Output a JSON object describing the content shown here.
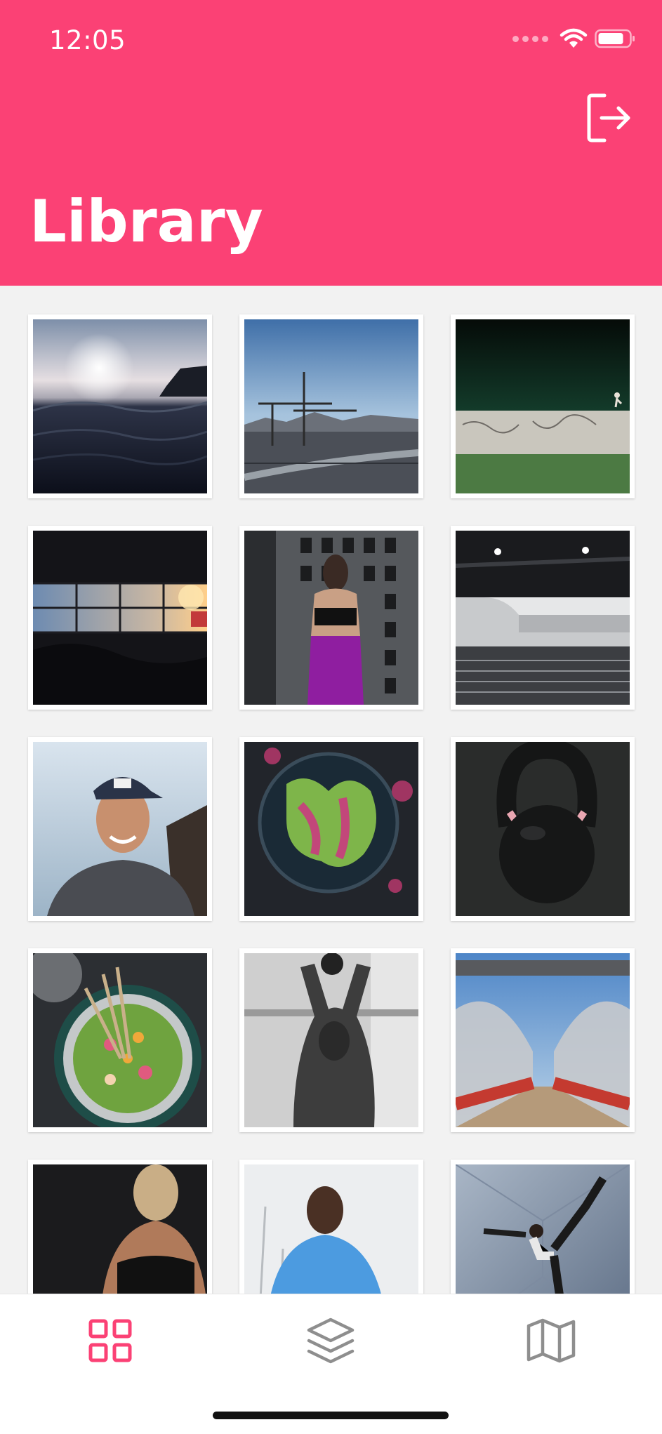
{
  "status_bar": {
    "time": "12:05"
  },
  "header": {
    "title": "Library",
    "color": "#fb4175"
  },
  "icons": {
    "logout": "logout-icon",
    "wifi": "wifi-icon",
    "battery": "battery-icon",
    "grid": "grid-icon",
    "layers": "layers-icon",
    "map": "map-icon"
  },
  "photos": [
    "ocean-sunset-photo",
    "city-cranes-photo",
    "wall-graffiti-runner-photo",
    "airport-lounge-photo",
    "woman-building-photo",
    "train-station-photo",
    "smiling-man-cap-photo",
    "lettuce-bowl-photo",
    "kettlebell-photo",
    "salad-bowl-photo",
    "man-kettlebell-photo",
    "bridge-photo",
    "woman-back-photo",
    "man-blue-shirt-photo",
    "yoga-pose-photo"
  ],
  "tabbar": {
    "active_tab": "grid",
    "active_color": "#fb4175",
    "inactive_color": "#8e8e8e"
  }
}
